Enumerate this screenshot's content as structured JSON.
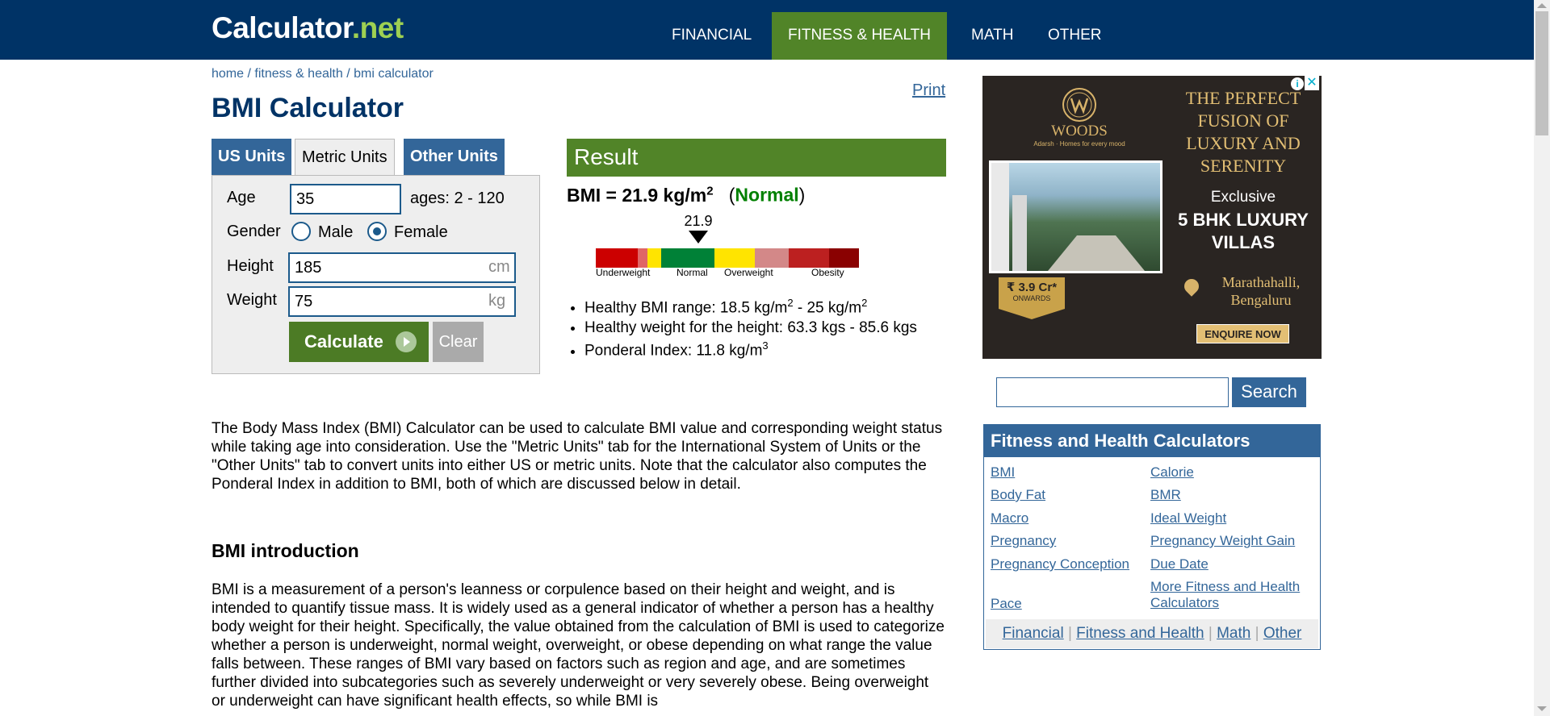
{
  "header": {
    "logo_main": "Calculator",
    "logo_net": ".net",
    "nav": [
      "FINANCIAL",
      "FITNESS & HEALTH",
      "MATH",
      "OTHER"
    ]
  },
  "breadcrumb": {
    "home": "home",
    "fitness": "fitness & health",
    "current": "bmi calculator",
    "separator": " / "
  },
  "page_title": "BMI Calculator",
  "print_label": "Print",
  "tabs": [
    "US Units",
    "Metric Units",
    "Other Units"
  ],
  "form": {
    "age_label": "Age",
    "age_value": "35",
    "age_hint": "ages: 2 - 120",
    "gender_label": "Gender",
    "gender_male": "Male",
    "gender_female": "Female",
    "gender_selected": "Female",
    "height_label": "Height",
    "height_value": "185",
    "height_unit": "cm",
    "weight_label": "Weight",
    "weight_value": "75",
    "weight_unit": "kg",
    "calculate_label": "Calculate",
    "clear_label": "Clear"
  },
  "result": {
    "header": "Result",
    "bmi_prefix": "BMI = 21.9 kg/m",
    "bmi_exp": "2",
    "status_open": "(",
    "status": "Normal",
    "status_close": ")",
    "gauge_value": "21.9",
    "gauge_labels": [
      "Underweight",
      "Normal",
      "Overweight",
      "Obesity"
    ],
    "healthy_range_text": "Healthy BMI range: 18.5 kg/m",
    "healthy_range_mid": " - 25 kg/m",
    "healthy_weight": "Healthy weight for the height: 63.3 kgs - 85.6 kgs",
    "ponderal": "Ponderal Index: 11.8 kg/m",
    "ponderal_exp": "3",
    "exp2": "2"
  },
  "colors": {
    "nav_bg": "#003366",
    "nav_active": "#518428",
    "link": "#336699",
    "result_green": "#518428",
    "gauge": [
      "#cc0000",
      "#e06666",
      "#ffe400",
      "#008137",
      "#ffe400",
      "#d38888",
      "#bc2020",
      "#8a0101"
    ]
  },
  "ad": {
    "brand": "WOODS",
    "brand_small": "Adarsh · Homes for every mood",
    "headline": "THE PERFECT FUSION OF LUXURY AND SERENITY",
    "exclusive": "Exclusive",
    "villas": "5 BHK LUXURY VILLAS",
    "price": "₹ 3.9 Cr*",
    "price_sub": "ONWARDS",
    "location": "Marathahalli, Bengaluru",
    "cta": "ENQUIRE NOW",
    "info_icon": "i",
    "close_icon": "✕"
  },
  "search": {
    "placeholder": "",
    "button": "Search"
  },
  "sidebar": {
    "title": "Fitness and Health Calculators",
    "links_left": [
      "BMI",
      "Body Fat",
      "Macro",
      "Pregnancy",
      "Pregnancy Conception",
      "Pace"
    ],
    "links_right": [
      "Calorie",
      "BMR",
      "Ideal Weight",
      "Pregnancy Weight Gain",
      "Due Date",
      "More Fitness and Health Calculators"
    ],
    "footer": [
      "Financial",
      "Fitness and Health",
      "Math",
      "Other"
    ],
    "footer_sep": " | "
  },
  "content": {
    "intro": "The Body Mass Index (BMI) Calculator can be used to calculate BMI value and corresponding weight status while taking age into consideration. Use the \"Metric Units\" tab for the International System of Units or the \"Other Units\" tab to convert units into either US or metric units. Note that the calculator also computes the Ponderal Index in addition to BMI, both of which are discussed below in detail.",
    "section_heading": "BMI introduction",
    "bmi_para": "BMI is a measurement of a person's leanness or corpulence based on their height and weight, and is intended to quantify tissue mass. It is widely used as a general indicator of whether a person has a healthy body weight for their height. Specifically, the value obtained from the calculation of BMI is used to categorize whether a person is underweight, normal weight, overweight, or obese depending on what range the value falls between. These ranges of BMI vary based on factors such as region and age, and are sometimes further divided into subcategories such as severely underweight or very severely obese. Being overweight or underweight can have significant health effects, so while BMI is"
  }
}
